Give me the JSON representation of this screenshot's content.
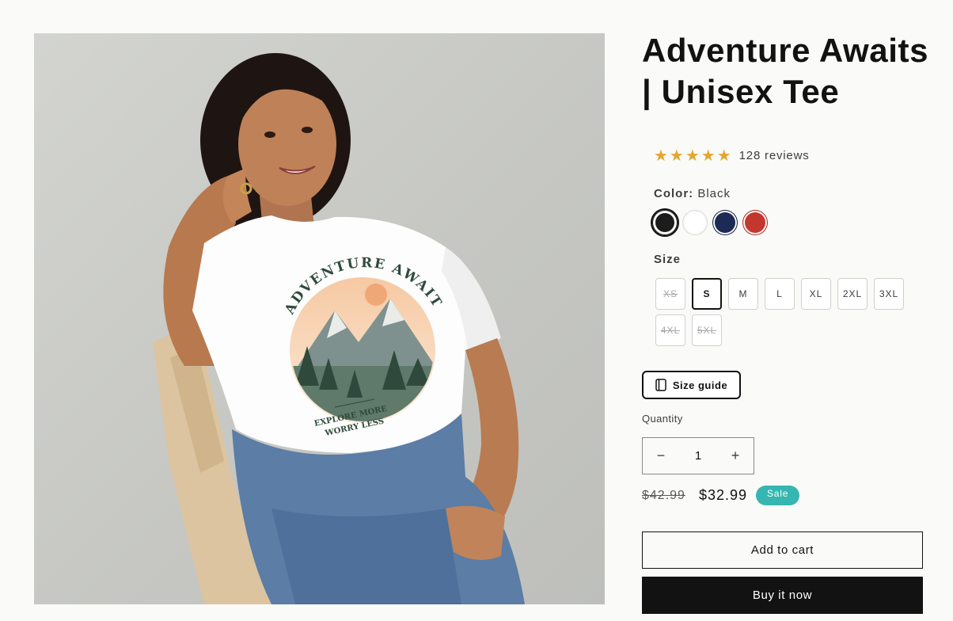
{
  "product": {
    "title": "Adventure Awaits | Unisex Tee",
    "rating_stars": "★★★★★",
    "rating_value": 5,
    "reviews_label": "128 reviews",
    "image_alt": "Woman wearing white Adventure Awaits tee",
    "shirt_print": {
      "arc_text": "ADVENTURE AWAITS",
      "line1": "EXPLORE MORE",
      "line2": "WORRY LESS"
    }
  },
  "color": {
    "label": "Color:",
    "selected": "Black",
    "swatches": [
      {
        "name": "Black",
        "hex": "#1c1c1c",
        "selected": true
      },
      {
        "name": "White",
        "hex": "#ffffff",
        "selected": false
      },
      {
        "name": "Navy",
        "hex": "#1d2a55",
        "selected": false
      },
      {
        "name": "Red",
        "hex": "#c4372d",
        "selected": false
      }
    ]
  },
  "size": {
    "label": "Size",
    "options": [
      {
        "label": "XS",
        "state": "unavailable"
      },
      {
        "label": "S",
        "state": "selected"
      },
      {
        "label": "M",
        "state": "available"
      },
      {
        "label": "L",
        "state": "available"
      },
      {
        "label": "XL",
        "state": "available"
      },
      {
        "label": "2XL",
        "state": "available"
      },
      {
        "label": "3XL",
        "state": "available"
      },
      {
        "label": "4XL",
        "state": "unavailable"
      },
      {
        "label": "5XL",
        "state": "unavailable"
      }
    ],
    "guide_label": "Size guide"
  },
  "quantity": {
    "label": "Quantity",
    "value": "1",
    "decrease": "−",
    "increase": "+"
  },
  "price": {
    "regular": "$42.99",
    "sale": "$32.99",
    "badge": "Sale"
  },
  "actions": {
    "add_to_cart": "Add to cart",
    "buy_now": "Buy it now"
  },
  "colors": {
    "accent_badge": "#36b6b0",
    "star": "#e3a72f",
    "primary_button": "#121212"
  }
}
